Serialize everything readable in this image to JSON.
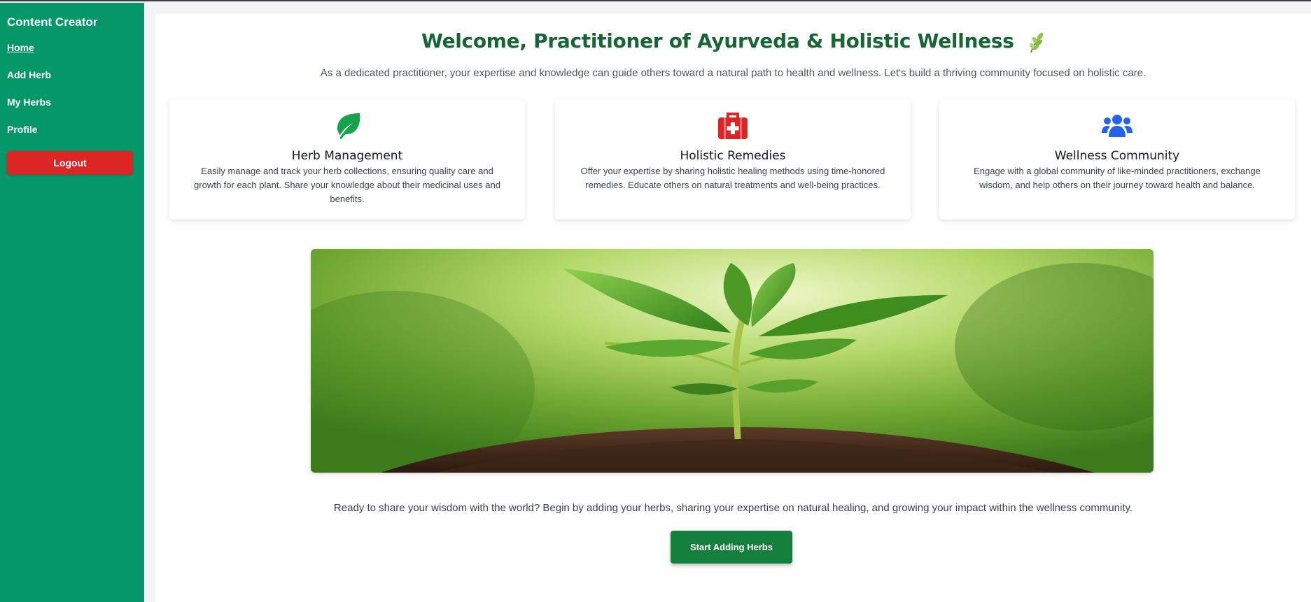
{
  "sidebar": {
    "brand": "Content Creator",
    "items": [
      {
        "label": "Home",
        "active": true
      },
      {
        "label": "Add Herb"
      },
      {
        "label": "My Herbs"
      },
      {
        "label": "Profile"
      }
    ],
    "logout_label": "Logout"
  },
  "main": {
    "title": "Welcome, Practitioner of Ayurveda & Holistic Wellness",
    "subtitle": "As a dedicated practitioner, your expertise and knowledge can guide others toward a natural path to health and wellness. Let's build a thriving community focused on holistic care.",
    "cards": [
      {
        "icon": "leaf-icon",
        "title": "Herb Management",
        "text": "Easily manage and track your herb collections, ensuring quality care and growth for each plant. Share your knowledge about their medicinal uses and benefits."
      },
      {
        "icon": "first-aid-kit-icon",
        "title": "Holistic Remedies",
        "text": "Offer your expertise by sharing holistic healing methods using time-honored remedies. Educate others on natural treatments and well-being practices."
      },
      {
        "icon": "users-icon",
        "title": "Wellness Community",
        "text": "Engage with a global community of like-minded practitioners, exchange wisdom, and help others on their journey toward health and balance."
      }
    ],
    "cta_text": "Ready to share your wisdom with the world? Begin by adding your herbs, sharing your expertise on natural healing, and growing your impact within the wellness community.",
    "cta_button": "Start Adding Herbs"
  },
  "colors": {
    "sidebar_bg": "#059669",
    "logout_bg": "#dc2626",
    "title": "#166534",
    "leaf_icon": "#16a34a",
    "kit_icon": "#dc2626",
    "users_icon": "#2563eb",
    "cta_bg": "#15803d"
  }
}
